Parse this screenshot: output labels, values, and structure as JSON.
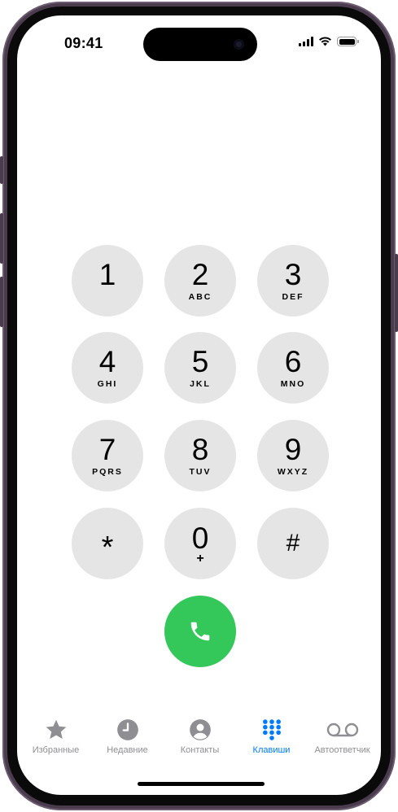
{
  "status_bar": {
    "time": "09:41"
  },
  "keypad": {
    "keys": [
      {
        "digit": "1",
        "letters": ""
      },
      {
        "digit": "2",
        "letters": "ABC"
      },
      {
        "digit": "3",
        "letters": "DEF"
      },
      {
        "digit": "4",
        "letters": "GHI"
      },
      {
        "digit": "5",
        "letters": "JKL"
      },
      {
        "digit": "6",
        "letters": "MNO"
      },
      {
        "digit": "7",
        "letters": "PQRS"
      },
      {
        "digit": "8",
        "letters": "TUV"
      },
      {
        "digit": "9",
        "letters": "WXYZ"
      },
      {
        "digit": "*",
        "letters": ""
      },
      {
        "digit": "0",
        "letters": "+"
      },
      {
        "digit": "#",
        "letters": ""
      }
    ]
  },
  "call_button": {
    "icon": "phone-icon",
    "color": "#34c759"
  },
  "tab_bar": {
    "active_color": "#007aff",
    "inactive_color": "#8e8e93",
    "tabs": [
      {
        "label": "Избранные",
        "icon": "star-icon"
      },
      {
        "label": "Недавние",
        "icon": "clock-icon"
      },
      {
        "label": "Контакты",
        "icon": "contact-icon"
      },
      {
        "label": "Клавиши",
        "icon": "keypad-icon",
        "active": true
      },
      {
        "label": "Автоответчик",
        "icon": "voicemail-icon"
      }
    ]
  }
}
